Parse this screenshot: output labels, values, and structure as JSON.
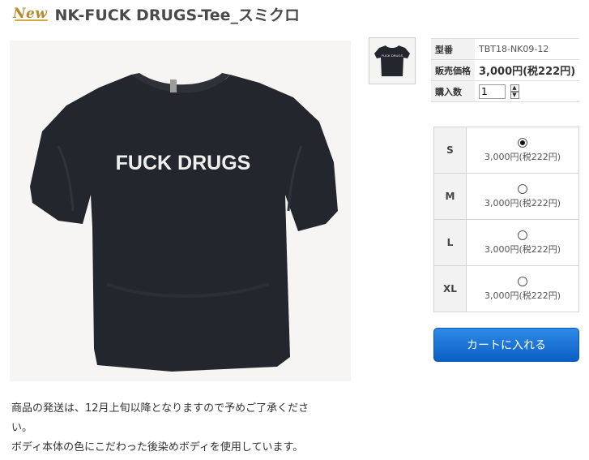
{
  "header": {
    "badge": "New",
    "title": "NK-FUCK DRUGS-Tee_スミクロ"
  },
  "product": {
    "shirt_print": "FUCK DRUGS",
    "thumbnail_print": "FUCK DRUGS"
  },
  "specs": [
    {
      "label": "型番",
      "value": "TBT18-NK09-12"
    },
    {
      "label": "販売価格",
      "value": "3,000円(税222円)"
    },
    {
      "label": "購入数",
      "value": "1"
    }
  ],
  "stepper": {
    "up": "▲",
    "down": "▼"
  },
  "sizes": [
    {
      "label": "S",
      "price": "3,000円(税222円)",
      "selected": true
    },
    {
      "label": "M",
      "price": "3,000円(税222円)",
      "selected": false
    },
    {
      "label": "L",
      "price": "3,000円(税222円)",
      "selected": false
    },
    {
      "label": "XL",
      "price": "3,000円(税222円)",
      "selected": false
    }
  ],
  "cart_button": {
    "label": "カートに入れる"
  },
  "description": {
    "line1": "商品の発送は、12月上旬以降となりますので予めご了承くださ",
    "line2": "い。",
    "line3": "ボディ本体の色にこだわった後染めボディを使用しています。"
  },
  "colors": {
    "shirt": "#23262c",
    "badge": "#b98a2c",
    "button": "#0b5fc4"
  }
}
